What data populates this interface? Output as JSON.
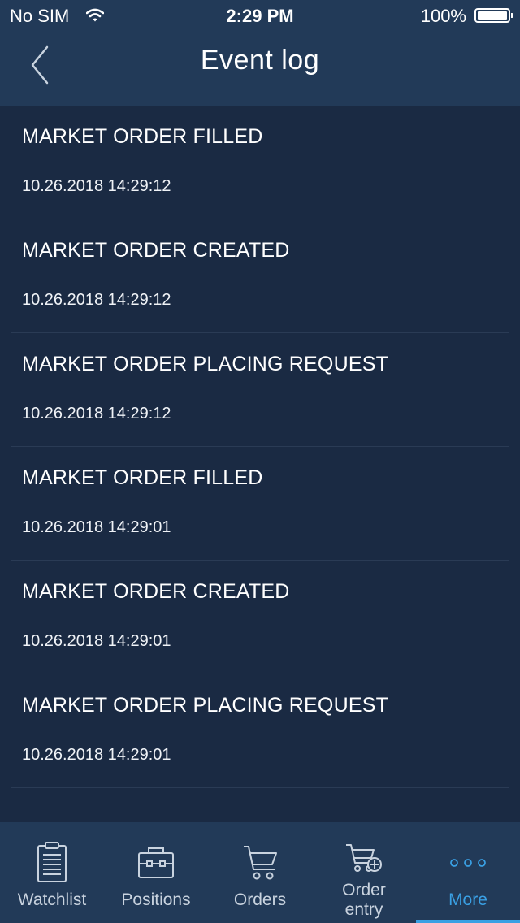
{
  "status_bar": {
    "carrier": "No SIM",
    "time": "2:29 PM",
    "battery_percent": "100%"
  },
  "nav": {
    "title": "Event log"
  },
  "events": [
    {
      "title": "MARKET ORDER FILLED",
      "time": "10.26.2018 14:29:12"
    },
    {
      "title": "MARKET ORDER CREATED",
      "time": "10.26.2018 14:29:12"
    },
    {
      "title": "MARKET ORDER PLACING REQUEST",
      "time": "10.26.2018 14:29:12"
    },
    {
      "title": "MARKET ORDER FILLED",
      "time": "10.26.2018 14:29:01"
    },
    {
      "title": "MARKET ORDER CREATED",
      "time": "10.26.2018 14:29:01"
    },
    {
      "title": "MARKET ORDER PLACING REQUEST",
      "time": "10.26.2018 14:29:01"
    }
  ],
  "tabs": {
    "watchlist": "Watchlist",
    "positions": "Positions",
    "orders": "Orders",
    "order_entry_line1": "Order",
    "order_entry_line2": "entry",
    "more": "More"
  },
  "colors": {
    "background": "#1a2a43",
    "bars": "#223a58",
    "accent": "#3aa0e4"
  }
}
